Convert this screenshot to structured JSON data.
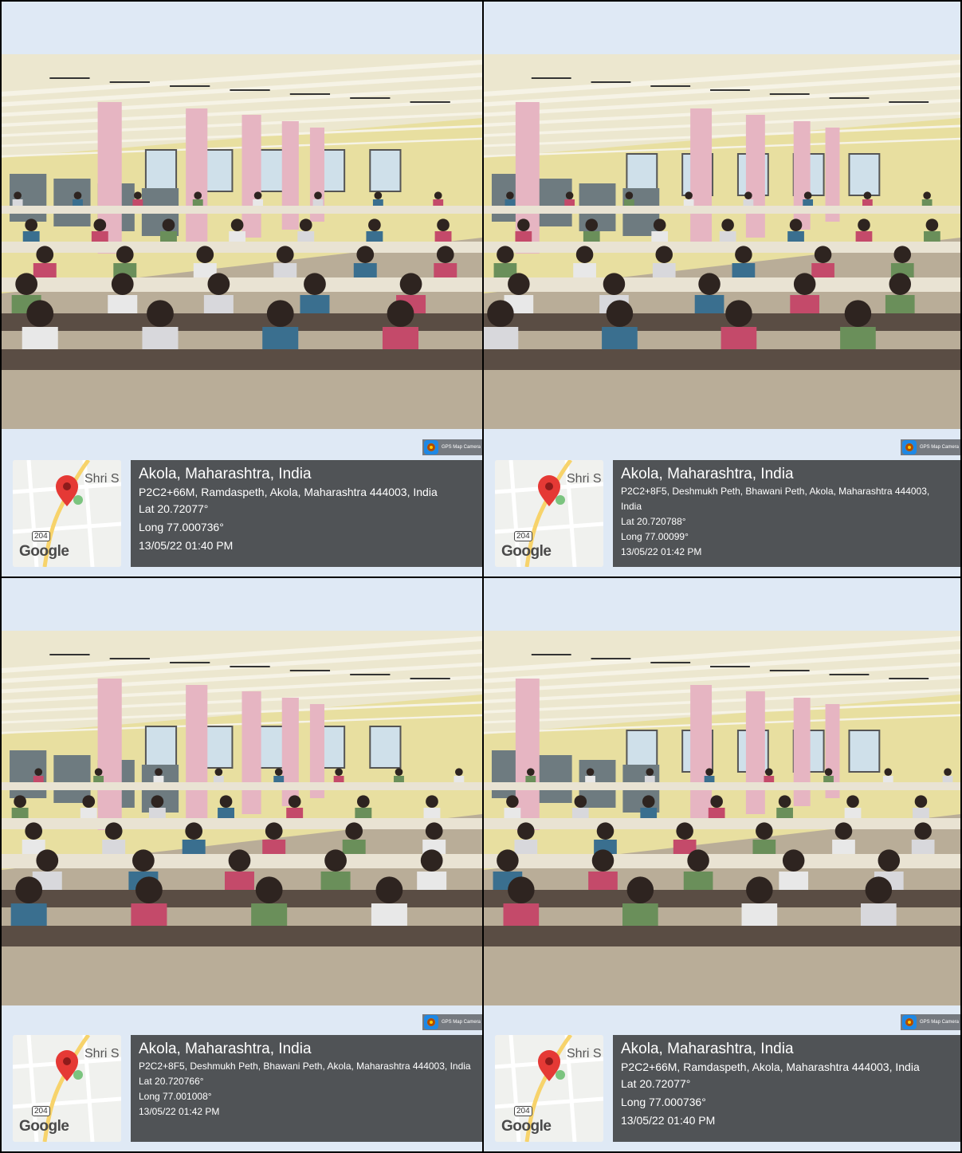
{
  "watermark_app": "GPS Map Camera",
  "map_label": "Shri S College",
  "map_brand": "Google",
  "map_road_number": "204",
  "cells": [
    {
      "city": "Akola, Maharashtra, India",
      "address": "P2C2+66M, Ramdaspeth, Akola, Maharashtra 444003, India",
      "lat": "Lat 20.72077°",
      "long": "Long 77.000736°",
      "datetime": "13/05/22 01:40 PM"
    },
    {
      "city": "Akola, Maharashtra, India",
      "address": "P2C2+8F5, Deshmukh Peth, Bhawani Peth, Akola, Maharashtra 444003, India",
      "lat": "Lat 20.720788°",
      "long": "Long 77.00099°",
      "datetime": "13/05/22 01:42 PM"
    },
    {
      "city": "Akola, Maharashtra, India",
      "address": "P2C2+8F5, Deshmukh Peth, Bhawani Peth, Akola, Maharashtra 444003, India",
      "lat": "Lat 20.720766°",
      "long": "Long 77.001008°",
      "datetime": "13/05/22 01:42 PM"
    },
    {
      "city": "Akola, Maharashtra, India",
      "address": "P2C2+66M, Ramdaspeth, Akola, Maharashtra 444003, India",
      "lat": "Lat 20.72077°",
      "long": "Long 77.000736°",
      "datetime": "13/05/22 01:40 PM"
    }
  ],
  "colors": {
    "page_bg": "#dfe9f5",
    "wall": "#e8dfa0",
    "ceiling": "#ece7cf",
    "pillar": "#e6b5c2",
    "table": "#5a4d44",
    "floor": "#b9ad98"
  }
}
